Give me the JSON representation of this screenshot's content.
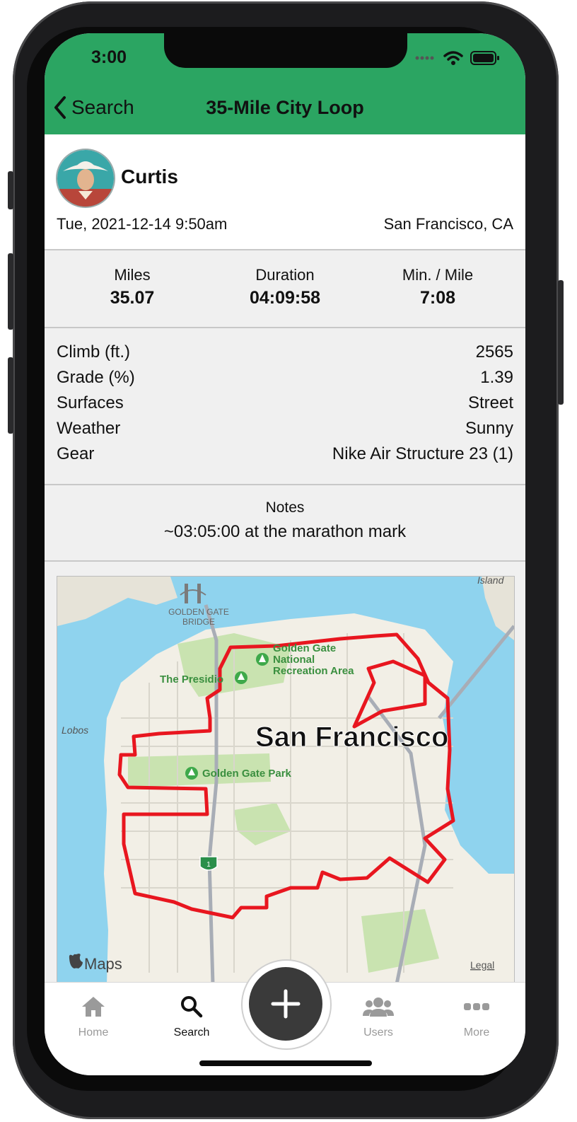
{
  "status_bar": {
    "time": "3:00"
  },
  "nav": {
    "back_label": "Search",
    "title": "35-Mile City Loop"
  },
  "profile": {
    "name": "Curtis",
    "datetime": "Tue, 2021-12-14 9:50am",
    "location": "San Francisco, CA"
  },
  "stats": [
    {
      "label": "Miles",
      "value": "35.07"
    },
    {
      "label": "Duration",
      "value": "04:09:58"
    },
    {
      "label": "Min. / Mile",
      "value": "7:08"
    }
  ],
  "details": [
    {
      "label": "Climb (ft.)",
      "value": "2565"
    },
    {
      "label": "Grade (%)",
      "value": "1.39"
    },
    {
      "label": "Surfaces",
      "value": "Street"
    },
    {
      "label": "Weather",
      "value": "Sunny"
    },
    {
      "label": "Gear",
      "value": "Nike Air Structure 23 (1)"
    }
  ],
  "notes": {
    "label": "Notes",
    "text": "~03:05:00 at the marathon mark"
  },
  "map": {
    "city": "San Francisco",
    "labels": {
      "bridge_line1": "GOLDEN GATE",
      "bridge_line2": "BRIDGE",
      "presidio": "The Presidio",
      "ggnra_1": "Golden Gate",
      "ggnra_2": "National",
      "ggnra_3": "Recreation Area",
      "ggpark": "Golden Gate Park",
      "lobos": "Lobos",
      "island": "Island",
      "highway": "1",
      "attribution": "Maps",
      "legal": "Legal"
    },
    "route_color": "#e8161f",
    "water_color": "#8fd3ee",
    "land_color": "#f2efe6",
    "park_color": "#c9e3b0"
  },
  "tabs": [
    {
      "label": "Home"
    },
    {
      "label": "Search"
    },
    {
      "label": "Users"
    },
    {
      "label": "More"
    }
  ],
  "theme": {
    "header_color": "#2ba562",
    "fab_color": "#3a3a3a"
  }
}
